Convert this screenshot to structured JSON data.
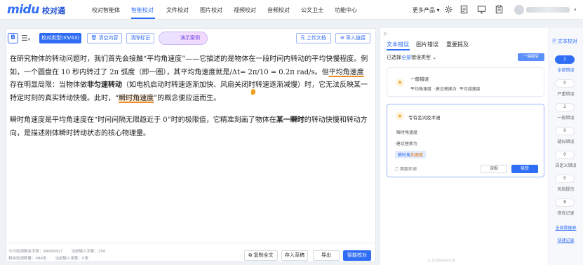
{
  "nav": {
    "logo": "midu",
    "logo_sub": "校对通",
    "items": [
      {
        "label": "校对智能体"
      },
      {
        "label": "智能校对"
      },
      {
        "label": "文件校对"
      },
      {
        "label": "图片校对"
      },
      {
        "label": "视频校对"
      },
      {
        "label": "音频校对"
      },
      {
        "label": "公文卫士"
      },
      {
        "label": "功能中心"
      }
    ],
    "active": "智能校对",
    "more_products": "更多产品",
    "icons": [
      "settings-icon",
      "document-icon",
      "monitor-icon",
      "clipboard-icon"
    ]
  },
  "toolbar": {
    "type_button": "校对类型(35/43)",
    "clear_content": "清空内容",
    "clear_marks": "清除标记",
    "demo_case": "演示案例",
    "upload_doc": "上传文档",
    "import_link": "导入链接"
  },
  "editor": {
    "p1": {
      "t1": "在研究物体的转动问题时，我们首先会接触“平均角速度”——它描述的是物体在一段时间内转动的平均快慢程度。例如，一个圆盘在 10 秒内转过了 2π 弧度（即一圈），其平均角速度就是/Δt= 2π/10 = 0.2π rad/s。但",
      "t2": "平均角速度",
      "t3": "存在明显局限：当物体做",
      "t4": "非匀速转动",
      "t5": "（如电机启动时转速逐渐加快、风扇关闭时转速逐渐减慢）时，它无法反映某一特定时刻的真实转动快慢。此时，“",
      "t6": "瞬时角速度",
      "t7": "”的概念便应运而生。"
    },
    "p2": {
      "t1": "瞬时角速度是平均角速度在“时间间隔无限趋近于 0”时的极限值，它精准刻画了物体在",
      "t2": "某一瞬时",
      "t3": "的转动快慢和转动方向，是描述刚体瞬时转动状态的核心物理量。"
    }
  },
  "stats": {
    "today_remaining": "今日检测剩余字数：99999427",
    "today_input": "当前输入字数：256",
    "remaining_total": "剩余检测数量：484张",
    "current_total": "当前输入张数：0张"
  },
  "bottom_buttons": {
    "copy_all": "复制全文",
    "save_draft": "存入草稿",
    "export": "导出",
    "smart_check": "智能校对"
  },
  "panel": {
    "tabs": [
      "文本错误",
      "图片错误",
      "重要提及"
    ],
    "filter_prefix": "已选择",
    "filter_all": "全部",
    "filter_suffix": "错误类型",
    "accept_all": "一键接受",
    "card1": {
      "type": "一般错误",
      "original": "平均角速度",
      "suggest": "建议替换为",
      "replacement": "平均减速度"
    },
    "card2": {
      "type": "专有名词及术语",
      "original": "瞬时角速度",
      "suggest": "建议替换为",
      "chip_a": "瞬时角",
      "chip_b": "加速度",
      "add_correct": "添加正词",
      "ignore": "误报",
      "accept": "接受"
    },
    "footer": "以上内容由AI生成"
  },
  "sidebar": {
    "title": "文本校对",
    "items": [
      {
        "count": "2",
        "label": "全部错误"
      },
      {
        "count": "0",
        "label": "严重错误"
      },
      {
        "count": "2",
        "label": "一般错误"
      },
      {
        "count": "0",
        "label": "疑似错误"
      },
      {
        "count": "0",
        "label": "自定义错误"
      },
      {
        "count": "0",
        "label": "风险提示"
      },
      {
        "count": "8",
        "label": "修改记录"
      }
    ],
    "link1": "全部数据表",
    "link2": "快速记录"
  },
  "colors": {
    "primary": "#2f6df6",
    "highlight_underline": "#f08a24",
    "highlight_bg": "#fde9cf"
  }
}
